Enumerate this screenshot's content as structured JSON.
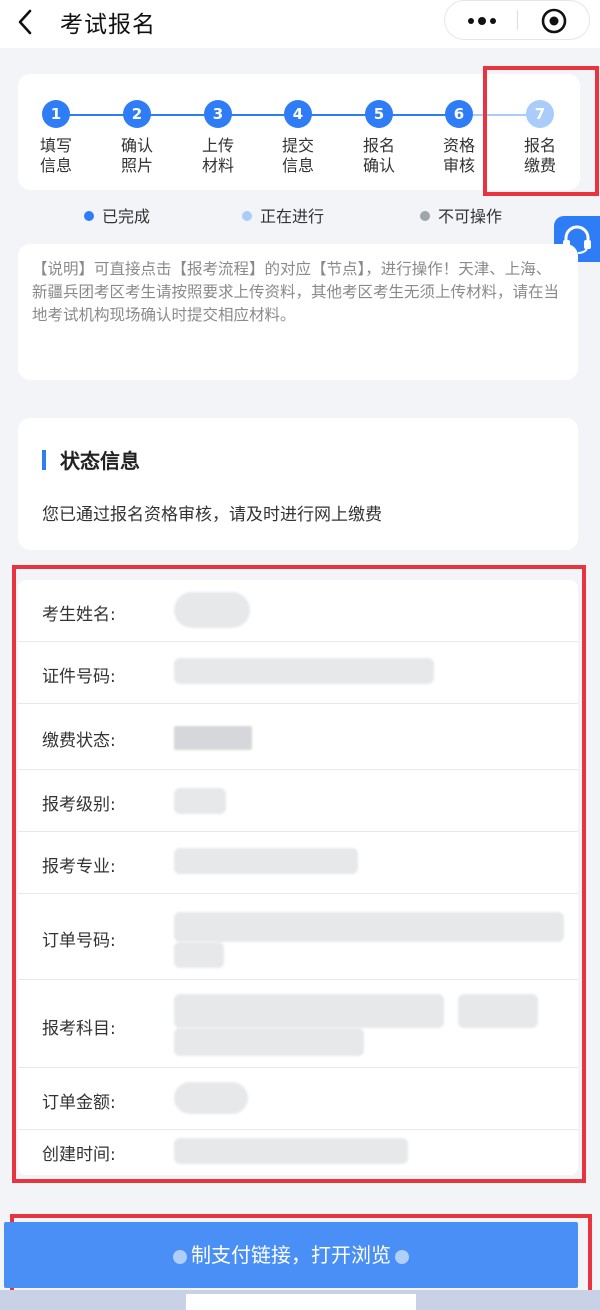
{
  "header": {
    "title": "考试报名",
    "back_icon": "chevron-left-icon",
    "more_icon": "more-dots-icon",
    "close_icon": "target-close-icon"
  },
  "steps": [
    {
      "num": "1",
      "label": "填写信息",
      "state": "done"
    },
    {
      "num": "2",
      "label": "确认照片",
      "state": "done"
    },
    {
      "num": "3",
      "label": "上传材料",
      "state": "done"
    },
    {
      "num": "4",
      "label": "提交信息",
      "state": "done"
    },
    {
      "num": "5",
      "label": "报名确认",
      "state": "done"
    },
    {
      "num": "6",
      "label": "资格审核",
      "state": "done"
    },
    {
      "num": "7",
      "label": "报名缴费",
      "state": "current"
    }
  ],
  "legend": {
    "done": "已完成",
    "in_progress": "正在进行",
    "disabled": "不可操作"
  },
  "notice": {
    "text": "【说明】可直接点击【报考流程】的对应【节点】，进行操作！天津、上海、新疆兵团考区考生请按照要求上传资料，其他考区考生无须上传材料，请在当地考试机构现场确认时提交相应材料。"
  },
  "status": {
    "heading": "状态信息",
    "message": "您已通过报名资格审核，请及时进行网上缴费"
  },
  "info_rows": [
    {
      "label": "考生姓名:"
    },
    {
      "label": "证件号码:"
    },
    {
      "label": "缴费状态:"
    },
    {
      "label": "报考级别:"
    },
    {
      "label": "报考专业:"
    },
    {
      "label": "订单号码:"
    },
    {
      "label": "报考科目:"
    },
    {
      "label": "订单金额:"
    },
    {
      "label": "创建时间:"
    }
  ],
  "pay_button": {
    "label": "制支付链接，打开浏览"
  },
  "colors": {
    "primary": "#2f7df6",
    "current_step": "#a9ccfb",
    "highlight": "#e8343f",
    "disabled": "#a0a4ab"
  }
}
